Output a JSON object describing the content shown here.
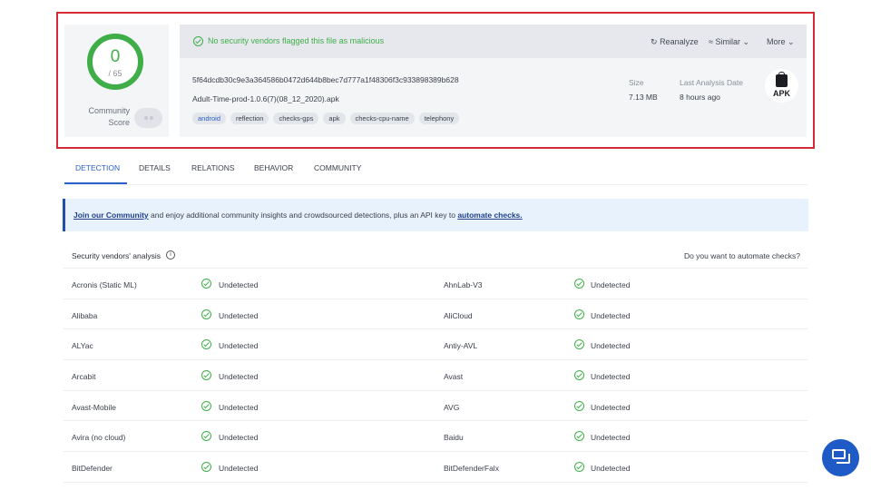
{
  "summary": {
    "score": {
      "value": "0",
      "denominator": "/ 65",
      "label_line1": "Community",
      "label_line2": "Score"
    },
    "header": {
      "message": "No security vendors flagged this file as malicious",
      "actions": {
        "reanalyze": "Reanalyze",
        "similar": "Similar",
        "more": "More"
      }
    },
    "file": {
      "hash": "5f64dcdb30c9e3a364586b0472d644b8bec7d777a1f48306f3c933898389b628",
      "name": "Adult-Time-prod-1.0.6(7)(08_12_2020).apk",
      "tags": [
        "android",
        "reflection",
        "checks-gps",
        "apk",
        "checks-cpu-name",
        "telephony"
      ]
    },
    "meta": {
      "size_label": "Size",
      "size_value": "7.13 MB",
      "date_label": "Last Analysis Date",
      "date_value": "8 hours ago"
    },
    "filetype": "APK"
  },
  "tabs": [
    "DETECTION",
    "DETAILS",
    "RELATIONS",
    "BEHAVIOR",
    "COMMUNITY"
  ],
  "banner": {
    "link1": "Join our Community",
    "middle": " and enjoy additional community insights and crowdsourced detections, plus an API key to ",
    "link2": "automate checks."
  },
  "vendors": {
    "title": "Security vendors' analysis",
    "automate_prompt": "Do you want to automate checks?",
    "rows": [
      {
        "left": "Acronis (Static ML)",
        "left_status": "Undetected",
        "right": "AhnLab-V3",
        "right_status": "Undetected"
      },
      {
        "left": "Alibaba",
        "left_status": "Undetected",
        "right": "AliCloud",
        "right_status": "Undetected"
      },
      {
        "left": "ALYac",
        "left_status": "Undetected",
        "right": "Antiy-AVL",
        "right_status": "Undetected"
      },
      {
        "left": "Arcabit",
        "left_status": "Undetected",
        "right": "Avast",
        "right_status": "Undetected"
      },
      {
        "left": "Avast-Mobile",
        "left_status": "Undetected",
        "right": "AVG",
        "right_status": "Undetected"
      },
      {
        "left": "Avira (no cloud)",
        "left_status": "Undetected",
        "right": "Baidu",
        "right_status": "Undetected"
      },
      {
        "left": "BitDefender",
        "left_status": "Undetected",
        "right": "BitDefenderFalx",
        "right_status": "Undetected"
      }
    ]
  },
  "colors": {
    "accent": "#2a60c8",
    "clean": "#3fae49",
    "highlight_border": "#d62b35"
  }
}
